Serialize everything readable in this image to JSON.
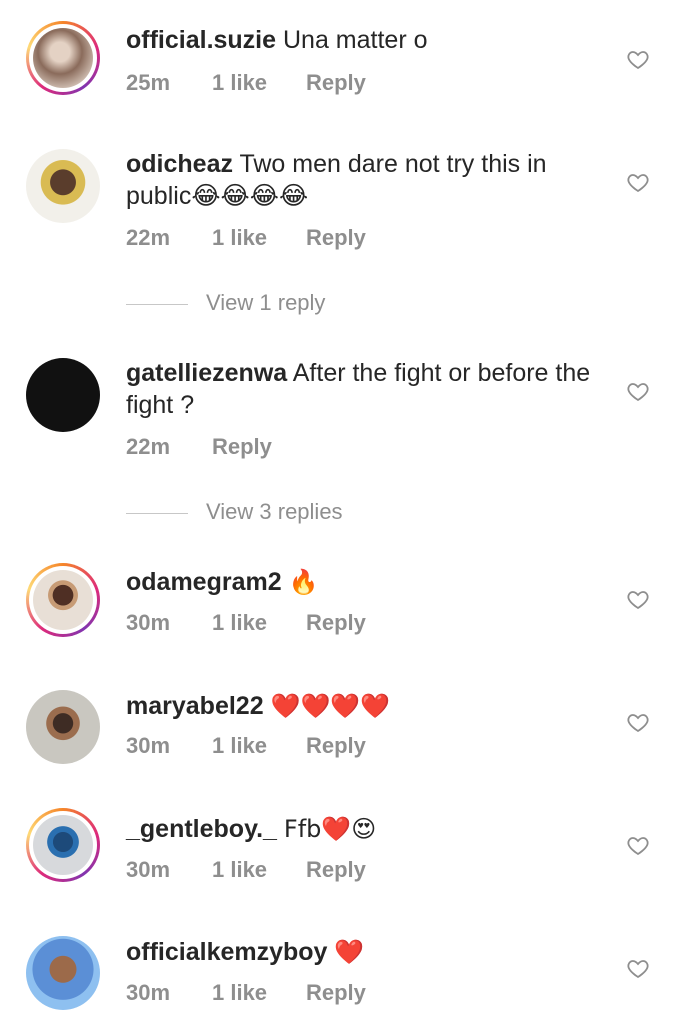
{
  "comments": [
    {
      "username": "official.suzie",
      "text": "Una matter o",
      "time": "25m",
      "likes": "1 like",
      "reply": "Reply"
    },
    {
      "username": "odicheaz",
      "text": "Two men dare not try this in public😂😂😂😂",
      "time": "22m",
      "likes": "1 like",
      "reply": "Reply",
      "view_replies": "View 1 reply"
    },
    {
      "username": "gatelliezenwa",
      "text": "After the fight or before the fight ?",
      "time": "22m",
      "likes": "",
      "reply": "Reply",
      "view_replies": "View 3 replies"
    },
    {
      "username": "odamegram2",
      "text": "🔥",
      "time": "30m",
      "likes": "1 like",
      "reply": "Reply"
    },
    {
      "username": "maryabel22",
      "text": "❤️❤️❤️❤️",
      "time": "30m",
      "likes": "1 like",
      "reply": "Reply"
    },
    {
      "username": "_gentleboy._",
      "text": "Ffb❤️😍",
      "time": "30m",
      "likes": "1 like",
      "reply": "Reply"
    },
    {
      "username": "officialkemzyboy",
      "text": "❤️",
      "time": "30m",
      "likes": "1 like",
      "reply": "Reply"
    }
  ],
  "colors": {
    "text": "#262626",
    "meta": "#8e8e8e",
    "heart_emoji": "#e0245e"
  }
}
